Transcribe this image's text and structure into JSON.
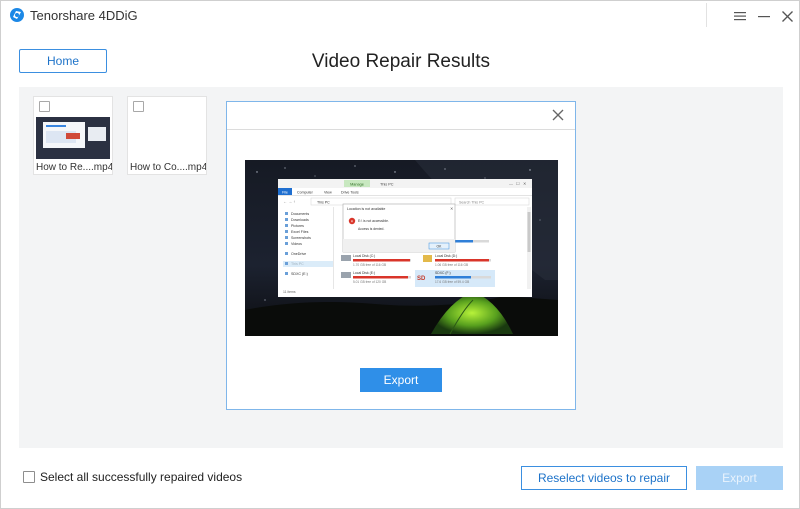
{
  "window": {
    "title": "Tenorshare 4DDiG",
    "logo_icon": "4ddig-logo-icon",
    "controls": [
      "menu-icon",
      "minimize-icon",
      "close-icon"
    ]
  },
  "header": {
    "home_label": "Home",
    "title": "Video Repair Results"
  },
  "videos": [
    {
      "name": "How to Re....mp4",
      "checked": false,
      "has_thumbnail": true
    },
    {
      "name": "How to Co....mp4",
      "checked": false,
      "has_thumbnail": false
    }
  ],
  "preview": {
    "close_icon": "close-icon",
    "export_label": "Export",
    "frame": {
      "explorer_ribbon_tabs": [
        "File",
        "Computer",
        "View",
        "Drive Tools"
      ],
      "manage_tab": "Manage",
      "explorer_tab_title": "This PC",
      "address": "This PC",
      "search_placeholder": "Search This PC",
      "sidebar_items": [
        "Documents",
        "Downloads",
        "Pictures",
        "Excel Files",
        "Screenshots",
        "Videos",
        "OneDrive",
        "This PC",
        "SDXC (E:)"
      ],
      "status": "11 items",
      "dialog": {
        "title": "Location is not available",
        "line1": "E:\\ is not accessible.",
        "line2": "Access is denied.",
        "ok_label": "OK"
      },
      "drives": [
        {
          "name": "Local Disk (C:)",
          "free": "1.70 GB free of 116 GB"
        },
        {
          "name": "Local Disk (D:)",
          "free": "1.06 GB free of 116 GB"
        },
        {
          "name": "Local Disk (E:)",
          "free": "5.01 GB free of 120 GB"
        },
        {
          "name": "SDXC (F:)",
          "free": "17.6 GB free of 59.4 GB"
        }
      ]
    }
  },
  "footer": {
    "select_all_label": "Select all successfully repaired videos",
    "select_all_checked": false,
    "reselect_label": "Reselect videos to repair",
    "export_label": "Export",
    "export_enabled": false
  },
  "colors": {
    "accent": "#2f8fe8",
    "accent_border": "#3b8fe0",
    "panel_bg": "#f3f4f5",
    "disabled_button": "#a9d2f6"
  }
}
